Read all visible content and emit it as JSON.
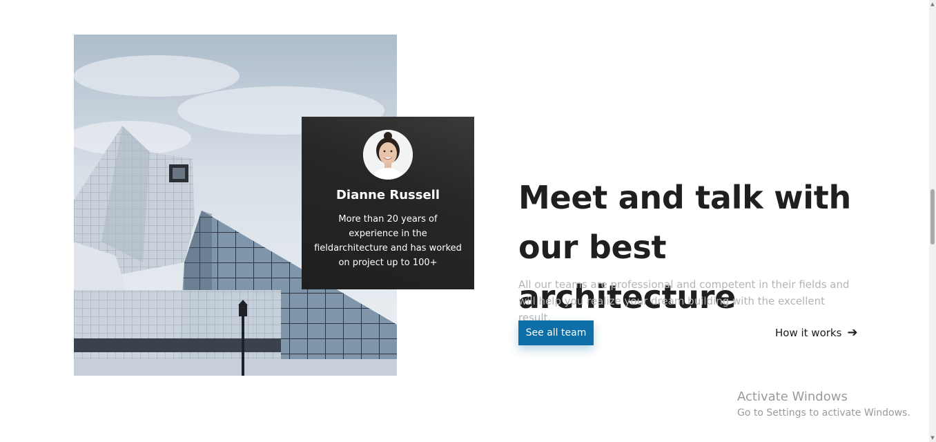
{
  "profile_card": {
    "name": "Dianne Russell",
    "bio": "More than 20 years of experience in the fieldarchitecture and has worked on project up to 100+"
  },
  "hero": {
    "headline": "Meet and talk with our best architecture",
    "description": "All our teams are professional and competent in their fields and will help you realize your dream building with the excellent result.",
    "primary_button": "See all team",
    "secondary_link": "How it works",
    "secondary_link_icon": "arrow-right-icon"
  },
  "windows_watermark": {
    "title": "Activate Windows",
    "subtitle": "Go to Settings to activate Windows."
  },
  "colors": {
    "accent": "#0e6fa8",
    "headline": "#1f1f1f",
    "muted_text": "#b4b4b4",
    "card_background": "#262626"
  }
}
